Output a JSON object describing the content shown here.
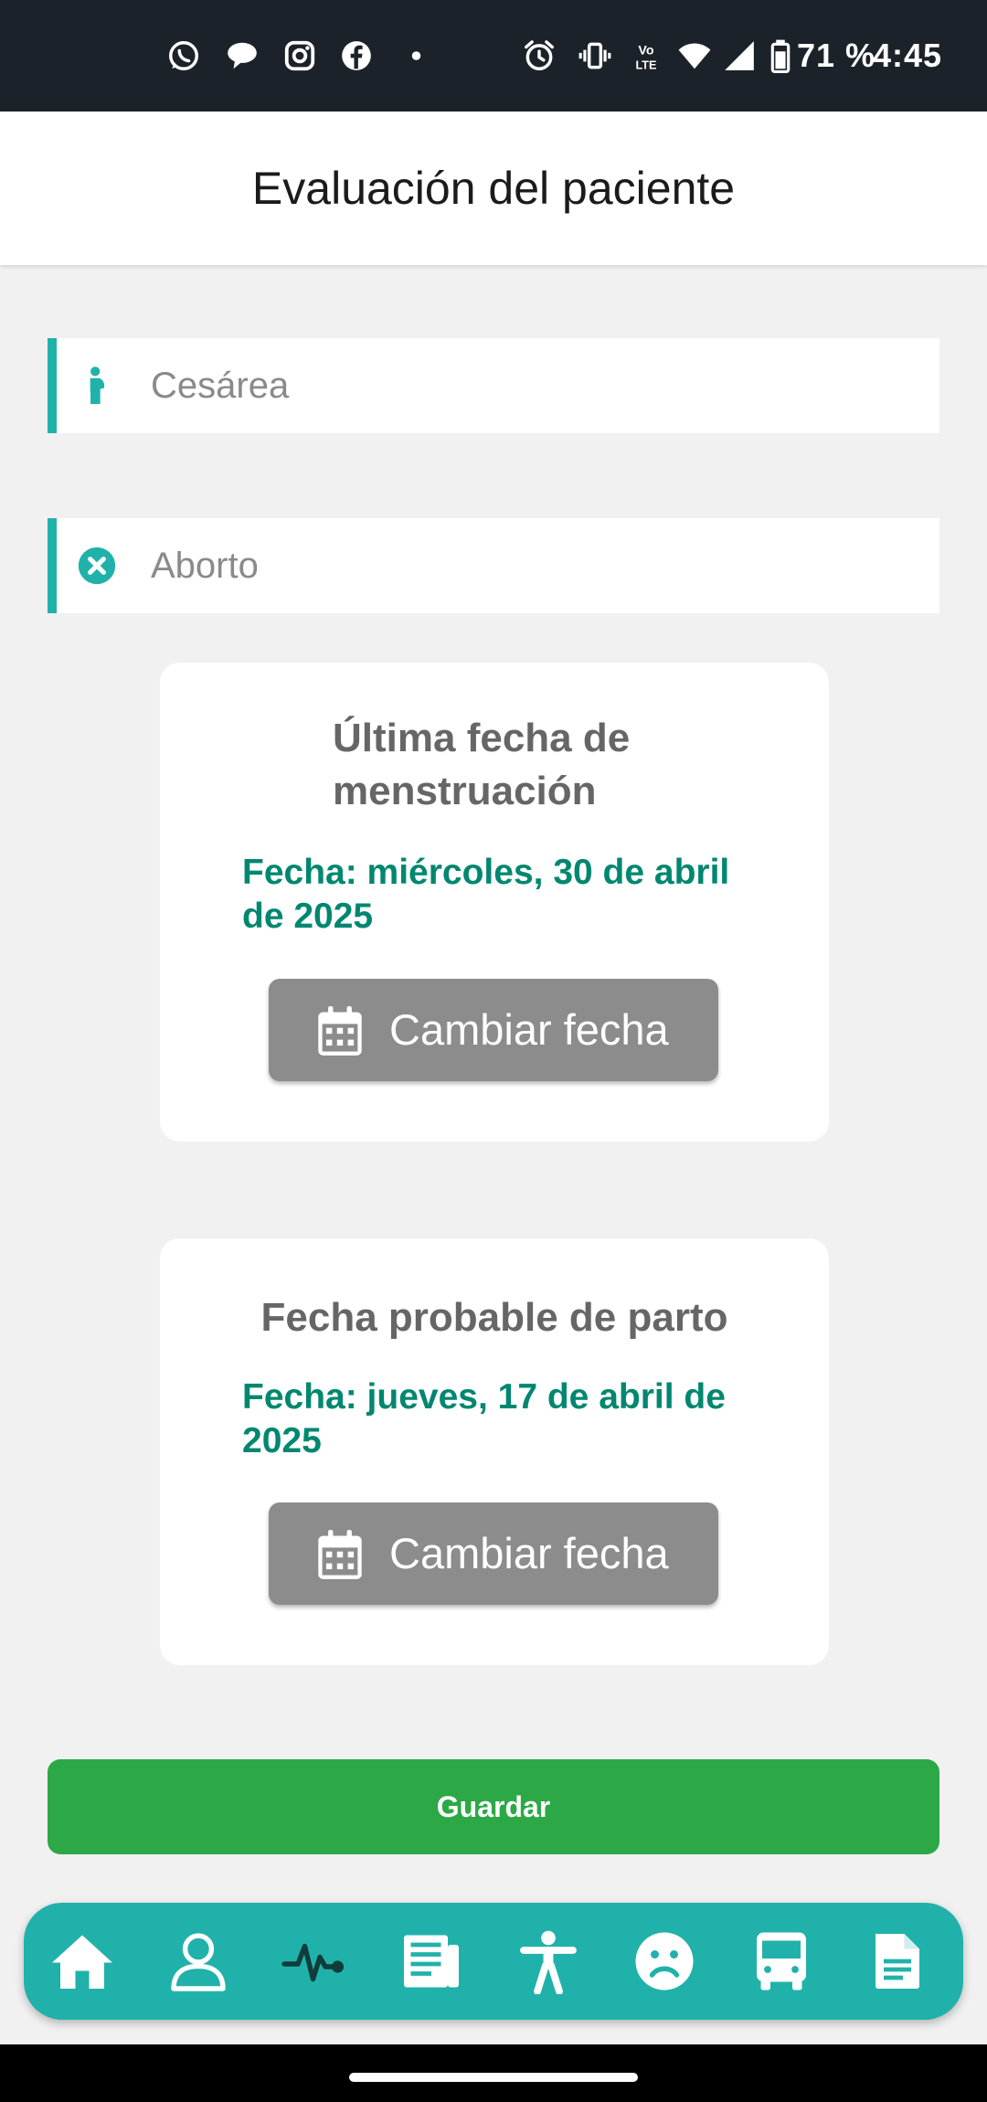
{
  "status_bar": {
    "battery": "71 %",
    "time": "4:45",
    "icons": [
      "whatsapp-icon",
      "chat-bubble-icon",
      "instagram-icon",
      "facebook-icon",
      "dot-icon",
      "alarm-icon",
      "vibrate-icon",
      "volte-icon",
      "wifi-icon",
      "signal-icon",
      "battery-icon"
    ]
  },
  "header": {
    "title": "Evaluación del paciente"
  },
  "fields": {
    "cesarea": {
      "label": "Cesárea",
      "icon": "pregnant-person-icon"
    },
    "aborto": {
      "label": "Aborto",
      "icon": "x-circle-icon"
    }
  },
  "cards": {
    "fum": {
      "title": "Última fecha de menstruación",
      "date": "Fecha: miércoles, 30 de abril de 2025",
      "button": "Cambiar fecha"
    },
    "fpp": {
      "title": "Fecha probable de parto",
      "date": "Fecha: jueves, 17 de abril de 2025",
      "button": "Cambiar fecha"
    }
  },
  "save_button": "Guardar",
  "bottom_nav": {
    "items": [
      "home-icon",
      "user-icon",
      "heartbeat-icon",
      "newspaper-icon",
      "person-standing-icon",
      "sad-face-icon",
      "bus-icon",
      "document-icon"
    ],
    "active": "heartbeat-icon"
  },
  "colors": {
    "accent": "#20b2aa",
    "date_text": "#00876f",
    "save_button": "#2ca846",
    "date_button": "#8c8c8c",
    "status_bar": "#1c2229"
  }
}
